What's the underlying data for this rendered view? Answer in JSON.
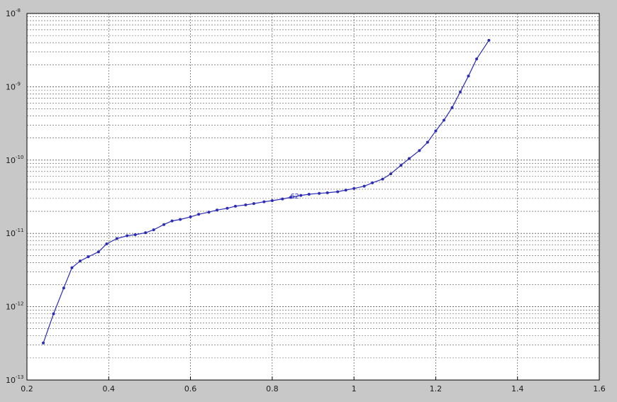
{
  "chart_data": {
    "type": "line",
    "title": "",
    "xlabel": "",
    "ylabel": "",
    "xlim": [
      0.2,
      1.6
    ],
    "ylim": [
      1e-13,
      1e-08
    ],
    "yscale": "log",
    "grid": true,
    "xticks": [
      "0.2",
      "0.4",
      "0.6",
      "0.8",
      "1",
      "1.2",
      "1.4",
      "1.6"
    ],
    "yticks": [
      {
        "base": "10",
        "exp": "-13",
        "value": 1e-13
      },
      {
        "base": "10",
        "exp": "-12",
        "value": 1e-12
      },
      {
        "base": "10",
        "exp": "-11",
        "value": 1e-11
      },
      {
        "base": "10",
        "exp": "-10",
        "value": 1e-10
      },
      {
        "base": "10",
        "exp": "-9",
        "value": 1e-09
      },
      {
        "base": "10",
        "exp": "-8",
        "value": 1e-08
      }
    ],
    "line_color": "#2b2bb8",
    "annotations": [
      {
        "text": "62",
        "x": 0.855,
        "y": 3.2e-11
      }
    ],
    "series": [
      {
        "x": [
          0.24,
          0.265,
          0.29,
          0.31,
          0.33,
          0.35,
          0.375,
          0.395,
          0.42,
          0.445,
          0.465,
          0.49,
          0.51,
          0.535,
          0.555,
          0.575,
          0.6,
          0.62,
          0.645,
          0.665,
          0.69,
          0.71,
          0.735,
          0.755,
          0.78,
          0.8,
          0.825,
          0.845,
          0.87,
          0.89,
          0.915,
          0.935,
          0.96,
          0.98,
          1.0,
          1.025,
          1.045,
          1.07,
          1.09,
          1.115,
          1.135,
          1.16,
          1.18,
          1.2,
          1.22,
          1.24,
          1.26,
          1.28,
          1.3,
          1.33
        ],
        "y": [
          3.2e-13,
          8e-13,
          1.8e-12,
          3.4e-12,
          4.2e-12,
          4.8e-12,
          5.6e-12,
          7.2e-12,
          8.5e-12,
          9.3e-12,
          9.6e-12,
          1.02e-11,
          1.12e-11,
          1.32e-11,
          1.48e-11,
          1.55e-11,
          1.68e-11,
          1.82e-11,
          1.95e-11,
          2.08e-11,
          2.2e-11,
          2.35e-11,
          2.45e-11,
          2.55e-11,
          2.7e-11,
          2.8e-11,
          2.95e-11,
          3.1e-11,
          3.3e-11,
          3.42e-11,
          3.52e-11,
          3.58e-11,
          3.7e-11,
          3.9e-11,
          4.1e-11,
          4.4e-11,
          4.9e-11,
          5.5e-11,
          6.5e-11,
          8.5e-11,
          1.05e-10,
          1.35e-10,
          1.75e-10,
          2.5e-10,
          3.5e-10,
          5.2e-10,
          8.5e-10,
          1.4e-09,
          2.4e-09,
          4.3e-09
        ]
      }
    ]
  }
}
